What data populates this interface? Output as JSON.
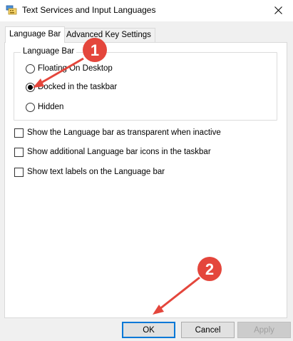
{
  "window": {
    "title": "Text Services and Input Languages",
    "app_icon": "keyboard-languages-icon",
    "close_icon": "close-icon"
  },
  "tabs": [
    {
      "label": "Language Bar",
      "active": true
    },
    {
      "label": "Advanced Key Settings",
      "active": false
    }
  ],
  "language_bar_group": {
    "legend": "Language Bar",
    "options": [
      {
        "label": "Floating On Desktop",
        "checked": false
      },
      {
        "label": "Docked in the taskbar",
        "checked": true
      },
      {
        "label": "Hidden",
        "checked": false
      }
    ]
  },
  "checkboxes": [
    {
      "label": "Show the Language bar as transparent when inactive",
      "checked": false
    },
    {
      "label": "Show additional Language bar icons in the taskbar",
      "checked": false
    },
    {
      "label": "Show text labels on the Language bar",
      "checked": false
    }
  ],
  "buttons": {
    "ok": "OK",
    "cancel": "Cancel",
    "apply": "Apply"
  },
  "annotations": [
    {
      "number": "1",
      "color": "#e4463c"
    },
    {
      "number": "2",
      "color": "#e4463c"
    }
  ]
}
